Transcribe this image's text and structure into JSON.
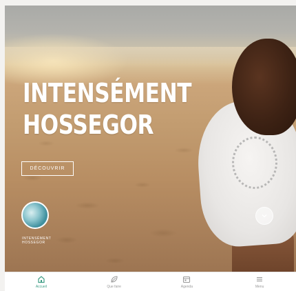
{
  "hero": {
    "title_line1": "INTENSÉMENT",
    "title_line2": "HOSSEGOR",
    "cta_label": "DÉCOUVRIR",
    "thumbnail_label_line1": "INTENSÉMENT",
    "thumbnail_label_line2": "HOSSEGOR"
  },
  "tabbar": {
    "items": [
      {
        "label": "Accueil",
        "icon": "home-icon",
        "active": true
      },
      {
        "label": "Que faire",
        "icon": "leaf-icon",
        "active": false
      },
      {
        "label": "Agenda",
        "icon": "calendar-icon",
        "active": false
      },
      {
        "label": "Menu",
        "icon": "menu-icon",
        "active": false
      }
    ]
  },
  "colors": {
    "accent": "#3f9e86",
    "inactive": "#9a9a9a",
    "text_on_image": "#ffffff"
  }
}
